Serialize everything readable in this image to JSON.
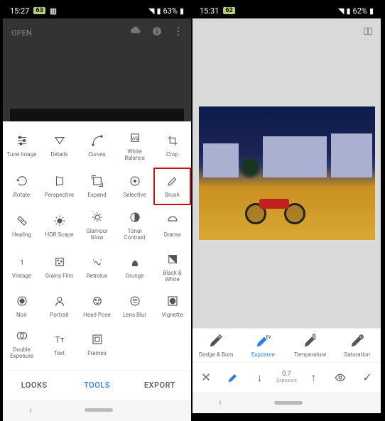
{
  "left": {
    "status": {
      "time": "15:27",
      "badge": "63",
      "battery": "63%"
    },
    "header": {
      "open": "OPEN"
    },
    "tools": [
      {
        "label": "Tune Image",
        "icon": "sliders"
      },
      {
        "label": "Details",
        "icon": "triangle-down"
      },
      {
        "label": "Curves",
        "icon": "curve"
      },
      {
        "label": "White\nBalance",
        "icon": "wb"
      },
      {
        "label": "Crop",
        "icon": "crop"
      },
      {
        "label": "Rotate",
        "icon": "rotate"
      },
      {
        "label": "Perspective",
        "icon": "perspective"
      },
      {
        "label": "Expand",
        "icon": "expand"
      },
      {
        "label": "Selective",
        "icon": "selective"
      },
      {
        "label": "Brush",
        "icon": "brush",
        "highlight": true
      },
      {
        "label": "Healing",
        "icon": "healing"
      },
      {
        "label": "HDR Scape",
        "icon": "hdr"
      },
      {
        "label": "Glamour\nGlow",
        "icon": "glow"
      },
      {
        "label": "Tonal\nContrast",
        "icon": "tonal"
      },
      {
        "label": "Drama",
        "icon": "drama"
      },
      {
        "label": "Vintage",
        "icon": "vintage"
      },
      {
        "label": "Grainy Film",
        "icon": "grainy"
      },
      {
        "label": "Retrolux",
        "icon": "retrolux"
      },
      {
        "label": "Grunge",
        "icon": "grunge"
      },
      {
        "label": "Black &\nWhite",
        "icon": "bw"
      },
      {
        "label": "Noir",
        "icon": "noir"
      },
      {
        "label": "Portrait",
        "icon": "portrait"
      },
      {
        "label": "Head Pose",
        "icon": "headpose"
      },
      {
        "label": "Lens Blur",
        "icon": "lensblur"
      },
      {
        "label": "Vignette",
        "icon": "vignette"
      },
      {
        "label": "Double\nExposure",
        "icon": "double"
      },
      {
        "label": "Text",
        "icon": "text"
      },
      {
        "label": "Frames",
        "icon": "frames"
      }
    ],
    "tabs": {
      "looks": "LOOKS",
      "tools": "TOOLS",
      "export": "EXPORT",
      "active": "tools"
    }
  },
  "right": {
    "status": {
      "time": "15:31",
      "badge": "62",
      "battery": "62%"
    },
    "brush_tabs": [
      {
        "label": "Dodge & Burn",
        "icon": "brush-sun"
      },
      {
        "label": "Exposure",
        "icon": "brush-ev",
        "active": true
      },
      {
        "label": "Temperature",
        "icon": "brush-temp"
      },
      {
        "label": "Saturation",
        "icon": "brush-sat"
      }
    ],
    "controls": {
      "close": "✕",
      "brush": "brush",
      "down": "↓",
      "value": "0.7",
      "value_label": "Exposure",
      "up": "↑",
      "eye": "eye",
      "check": "✓"
    }
  }
}
